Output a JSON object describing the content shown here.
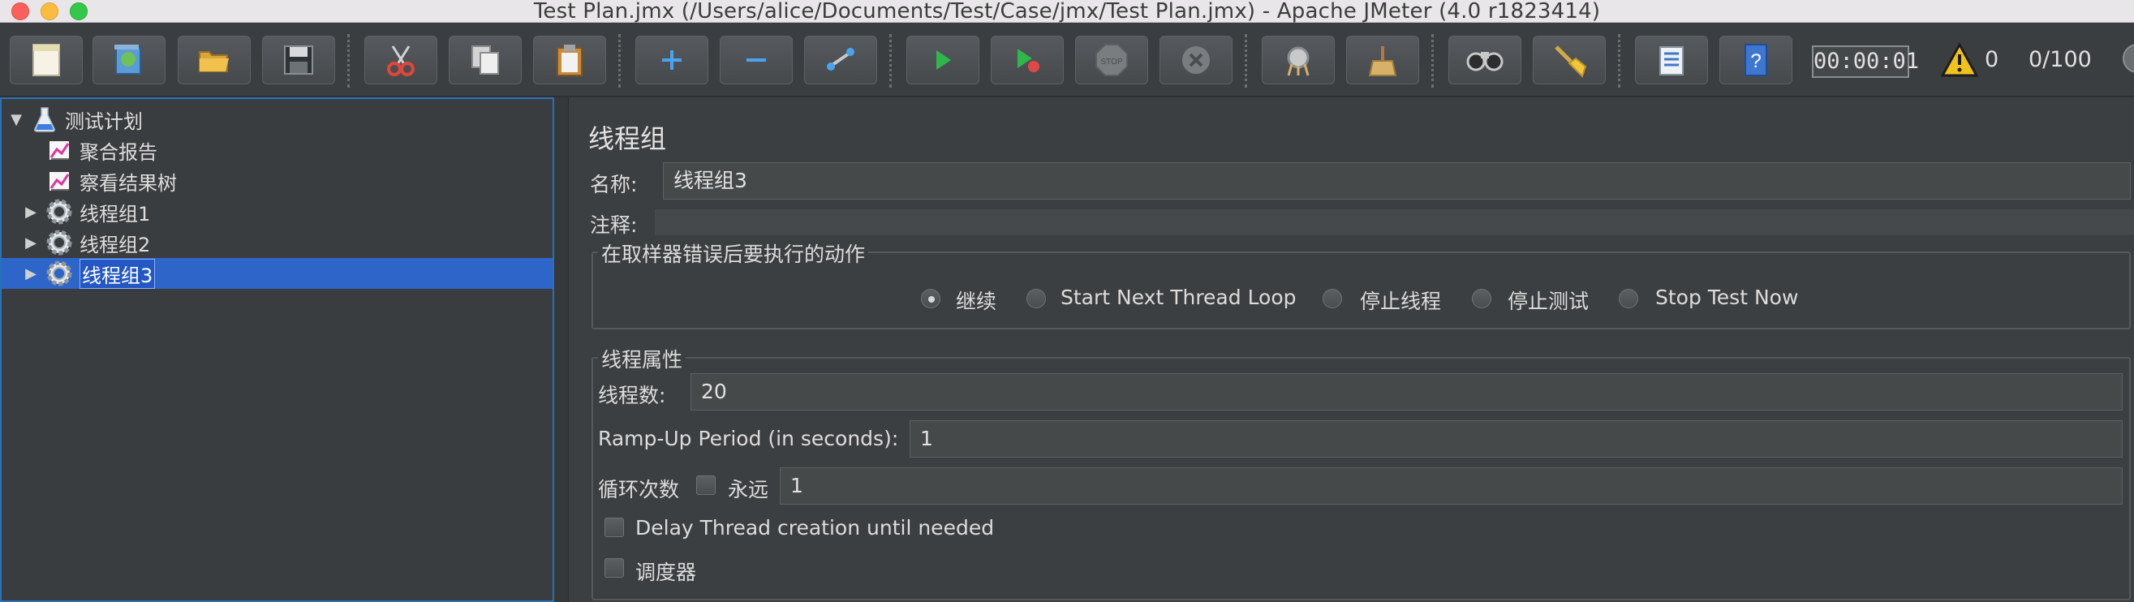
{
  "window": {
    "title": "Test Plan.jmx (/Users/alice/Documents/Test/Case/jmx/Test Plan.jmx) - Apache JMeter (4.0 r1823414)"
  },
  "toolbar": {
    "buttons": [
      "new-icon",
      "templates-icon",
      "open-icon",
      "save-icon",
      "cut-icon",
      "copy-icon",
      "paste-icon",
      "expand-icon",
      "collapse-icon",
      "toggle-icon",
      "start-icon",
      "start-no-pauses-icon",
      "stop-icon",
      "shutdown-icon",
      "clear-icon",
      "clear-all-icon",
      "search-icon",
      "reset-search-icon",
      "function-helper-icon",
      "help-icon"
    ],
    "elapsed": "00:00:01",
    "error_count": "0",
    "threads": "0/100"
  },
  "tree": {
    "root": "测试计划",
    "items": [
      {
        "label": "聚合报告"
      },
      {
        "label": "察看结果树"
      },
      {
        "label": "线程组1"
      },
      {
        "label": "线程组2"
      },
      {
        "label": "线程组3"
      }
    ]
  },
  "panel": {
    "title": "线程组",
    "name_label": "名称:",
    "name_value": "线程组3",
    "comment_label": "注释:",
    "comment_value": "",
    "action_legend": "在取样器错误后要执行的动作",
    "actions": [
      "继续",
      "Start Next Thread Loop",
      "停止线程",
      "停止测试",
      "Stop Test Now"
    ],
    "selected_action": "继续",
    "props_legend": "线程属性",
    "threads_label": "线程数:",
    "threads_value": "20",
    "rampup_label": "Ramp-Up Period (in seconds):",
    "rampup_value": "1",
    "loop_label": "循环次数",
    "forever_label": "永远",
    "loop_value": "1",
    "delay_label": "Delay Thread creation until needed",
    "scheduler_label": "调度器"
  },
  "colors": {
    "selection": "#2e65c9",
    "panel_bg": "#3c3f41"
  }
}
